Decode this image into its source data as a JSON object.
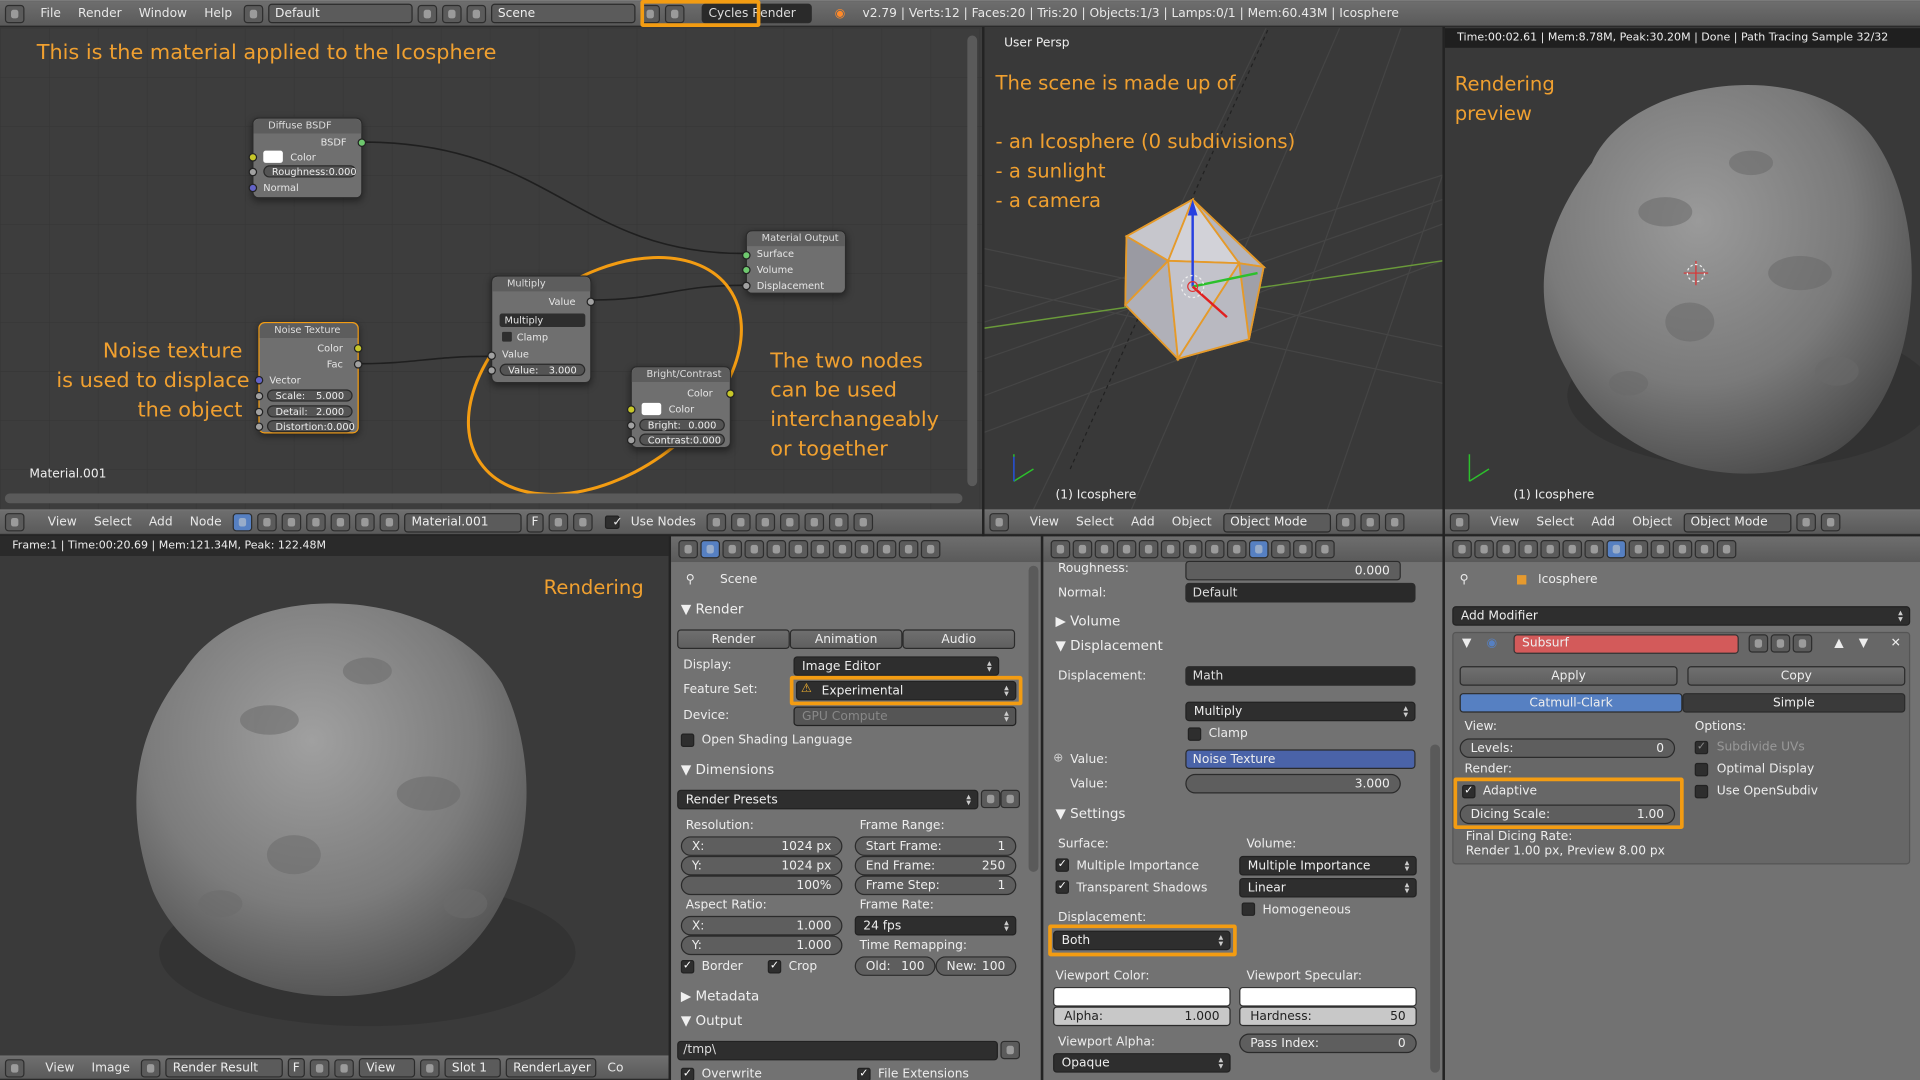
{
  "topbar": {
    "menus": [
      "File",
      "Render",
      "Window",
      "Help"
    ],
    "layout": "Default",
    "scene": "Scene",
    "engine": "Cycles Render",
    "stats": "v2.79 | Verts:12 | Faces:20 | Tris:20 | Objects:1/3 | Lamps:0/1 | Mem:60.43M | Icosphere"
  },
  "node_editor": {
    "annotation_top": "This is the material applied to the Icosphere",
    "annotation_left": "Noise texture\nis used to displace\nthe object",
    "annotation_right": "The two nodes\ncan be used\ninterchangeably\nor together",
    "material_label": "Material.001",
    "diffuse": {
      "title": "Diffuse BSDF",
      "out": "BSDF",
      "color": "Color",
      "roughness": "Roughness:",
      "roughness_val": "0.000",
      "normal": "Normal"
    },
    "output": {
      "title": "Material Output",
      "surface": "Surface",
      "volume": "Volume",
      "displacement": "Displacement"
    },
    "multiply": {
      "title": "Multiply",
      "out": "Value",
      "op": "Multiply",
      "clamp": "Clamp",
      "value_in": "Value",
      "value_label": "Value:",
      "value": "3.000"
    },
    "noise": {
      "title": "Noise Texture",
      "color": "Color",
      "fac": "Fac",
      "vector": "Vector",
      "scale": "Scale:",
      "scale_val": "5.000",
      "detail": "Detail:",
      "detail_val": "2.000",
      "distortion": "Distortion:",
      "distortion_val": "0.000"
    },
    "bc": {
      "title": "Bright/Contrast",
      "color_out": "Color",
      "color_in": "Color",
      "bright": "Bright:",
      "bright_val": "0.000",
      "contrast": "Contrast:",
      "contrast_val": "0.000"
    },
    "header": {
      "menus": [
        "View",
        "Select",
        "Add",
        "Node"
      ],
      "material": "Material.001",
      "f": "F",
      "use_nodes": "Use Nodes"
    }
  },
  "viewport": {
    "label": "User Persp",
    "annotation": "The scene is made up of\n\n- an Icosphere (0 subdivisions)\n- a sunlight\n- a camera",
    "object_label": "(1) Icosphere",
    "header": {
      "menus": [
        "View",
        "Select",
        "Add",
        "Object"
      ],
      "mode": "Object Mode"
    }
  },
  "preview": {
    "status": "Time:00:02.61 | Mem:8.78M, Peak:30.20M | Done | Path Tracing Sample 32/32",
    "annotation": "Rendering\npreview",
    "object_label": "(1) Icosphere",
    "header": {
      "menus": [
        "View",
        "Select",
        "Add",
        "Object"
      ],
      "mode": "Object Mode"
    }
  },
  "render_view": {
    "status": "Frame:1 | Time:00:20.69 | Mem:121.34M, Peak: 122.48M",
    "annotation": "Rendering",
    "header": {
      "menus": [
        "View",
        "Image"
      ],
      "result": "Render Result",
      "f": "F",
      "view": "View",
      "slot": "Slot 1",
      "layer": "RenderLayer",
      "co": "Co"
    }
  },
  "render_props": {
    "scene": "Scene",
    "render_section": "Render",
    "buttons": [
      "Render",
      "Animation",
      "Audio"
    ],
    "display_label": "Display:",
    "display": "Image Editor",
    "feature_label": "Feature Set:",
    "feature": "Experimental",
    "device_label": "Device:",
    "device": "GPU Compute",
    "osl": "Open Shading Language",
    "dimensions": "Dimensions",
    "presets": "Render Presets",
    "resolution": "Resolution:",
    "res_x_l": "X:",
    "res_x": "1024 px",
    "res_y_l": "Y:",
    "res_y": "1024 px",
    "res_pct": "100%",
    "frame_range": "Frame Range:",
    "start_l": "Start Frame:",
    "start": "1",
    "end_l": "End Frame:",
    "end": "250",
    "step_l": "Frame Step:",
    "step": "1",
    "aspect": "Aspect Ratio:",
    "ax_l": "X:",
    "ax": "1.000",
    "ay_l": "Y:",
    "ay": "1.000",
    "frame_rate": "Frame Rate:",
    "fps": "24 fps",
    "remap": "Time Remapping:",
    "old_l": "Old:",
    "old": "100",
    "new_l": "New:",
    "new": "100",
    "border": "Border",
    "crop": "Crop",
    "metadata": "Metadata",
    "output": "Output",
    "path": "/tmp\\",
    "overwrite": "Overwrite",
    "file_ext": "File Extensions"
  },
  "material_props": {
    "roughness_l": "Roughness:",
    "roughness": "0.000",
    "normal_l": "Normal:",
    "normal": "Default",
    "volume": "Volume",
    "displacement_sec": "Displacement",
    "disp_l": "Displacement:",
    "disp": "Math",
    "op": "Multiply",
    "clamp": "Clamp",
    "value1_l": "Value:",
    "value1": "Noise Texture",
    "value2_l": "Value:",
    "value2": "3.000",
    "settings": "Settings",
    "surface": "Surface:",
    "volume_l": "Volume:",
    "mis": "Multiple Importance",
    "vmis": "Multiple Importance",
    "ts": "Transparent Shadows",
    "interp": "Linear",
    "homog": "Homogeneous",
    "disp_method_l": "Displacement:",
    "disp_method": "Both",
    "vp_color": "Viewport Color:",
    "vp_spec": "Viewport Specular:",
    "alpha_l": "Alpha:",
    "alpha": "1.000",
    "hard_l": "Hardness:",
    "hard": "50",
    "vp_alpha": "Viewport Alpha:",
    "opaque": "Opaque",
    "pass_l": "Pass Index:",
    "pass": "0"
  },
  "modifier_props": {
    "object": "Icosphere",
    "add": "Add Modifier",
    "name": "Subsurf",
    "apply": "Apply",
    "copy": "Copy",
    "cc": "Catmull-Clark",
    "simple": "Simple",
    "view": "View:",
    "levels_l": "Levels:",
    "levels": "0",
    "options": "Options:",
    "subuv": "Subdivide UVs",
    "optimal": "Optimal Display",
    "opensubdiv": "Use OpenSubdiv",
    "render": "Render:",
    "adaptive": "Adaptive",
    "dicing_l": "Dicing Scale:",
    "dicing": "1.00",
    "final": "Final Dicing Rate:",
    "final_val": "Render 1.00 px, Preview 8.00 px"
  },
  "colors": {
    "accent": "#f39c12",
    "blue": "#5680c2",
    "modifier_red": "#d35a5a"
  }
}
